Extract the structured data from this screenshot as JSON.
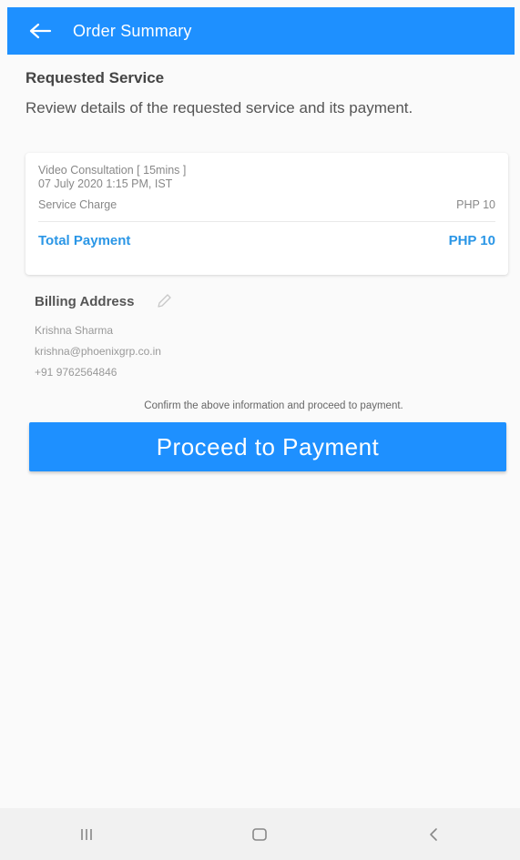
{
  "appbar": {
    "title": "Order Summary",
    "back_icon": "arrow-left-icon",
    "color": "#1e90ff"
  },
  "service": {
    "title": "Requested Service",
    "description": "Review details of the requested service and its payment.",
    "name": "Video Consultation [ 15mins ]",
    "datetime": "07 July 2020 1:15 PM, IST",
    "charge_label": "Service Charge",
    "charge_value": "PHP 10",
    "total_label": "Total Payment",
    "total_value": "PHP 10",
    "accent_color": "#2a96e6"
  },
  "billing": {
    "title": "Billing Address",
    "edit_icon": "pencil-icon",
    "name": "Krishna Sharma",
    "email": "krishna@phoenixgrp.co.in",
    "phone": "+91 9762564846"
  },
  "confirm_text": "Confirm the above information and proceed to payment.",
  "proceed_label": "Proceed to Payment",
  "navbar": {
    "recent_icon": "recent-apps-icon",
    "home_icon": "home-icon",
    "back_icon": "nav-back-icon"
  }
}
